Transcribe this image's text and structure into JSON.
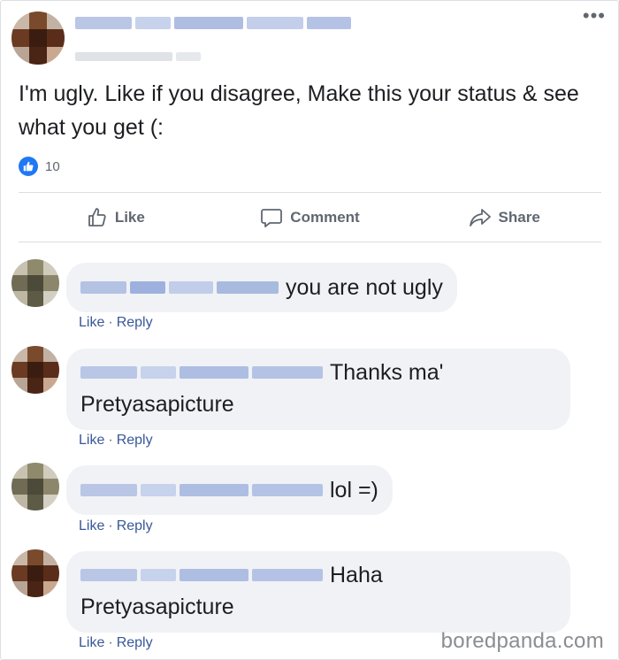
{
  "post": {
    "author_name": "",
    "more_glyph": "•••",
    "status_text": "I'm ugly. Like if you disagree, Make this your status & see what you get (:",
    "like_count": "10"
  },
  "actions": {
    "like": "Like",
    "comment": "Comment",
    "share": "Share"
  },
  "comments": [
    {
      "text": "you are not ugly",
      "like": "Like",
      "reply": "Reply"
    },
    {
      "text": "Thanks ma' Pretyasapicture",
      "like": "Like",
      "reply": "Reply"
    },
    {
      "text": "lol =)",
      "like": "Like",
      "reply": "Reply"
    },
    {
      "text": "Haha Pretyasapicture",
      "like": "Like",
      "reply": "Reply"
    }
  ],
  "comment_lines": {
    "c1_line1": "Thanks ma'",
    "c1_line2": "Pretyasapicture",
    "c3_line1": "Haha",
    "c3_line2": "Pretyasapicture"
  },
  "watermark": "boredpanda.com",
  "colors": {
    "accent": "#385898",
    "like_blue": "#2078f4",
    "bubble_bg": "#f0f2f5",
    "blur_blue": "#a9b9dd"
  },
  "icons": [
    "more-options-icon",
    "like-reaction-icon",
    "thumbs-up-icon",
    "comment-icon",
    "share-arrow-icon"
  ]
}
